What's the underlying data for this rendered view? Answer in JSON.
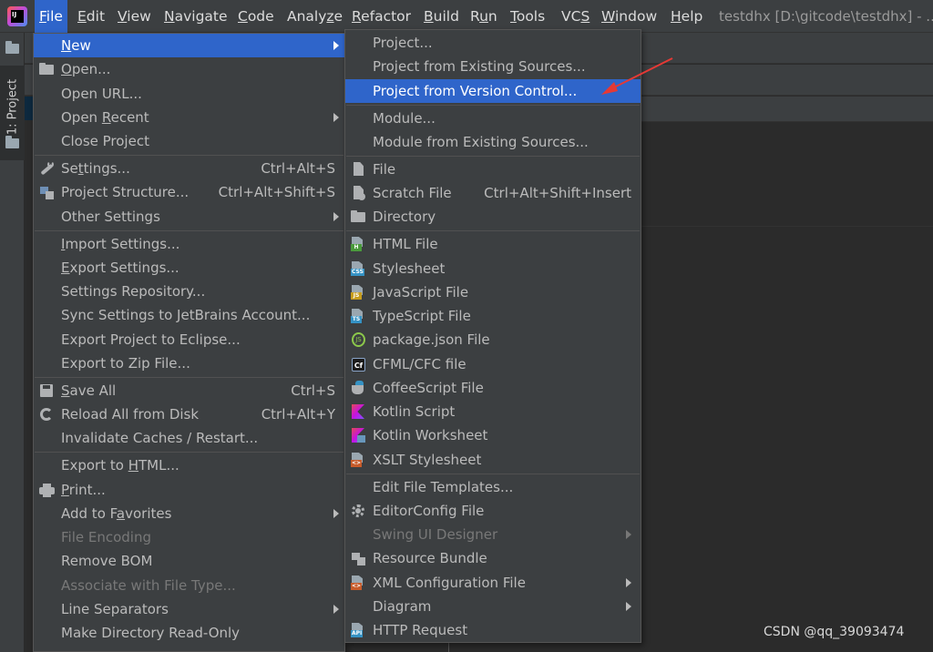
{
  "menubar": {
    "items": [
      {
        "pre": "",
        "mn": "F",
        "post": "ile",
        "active": true
      },
      {
        "pre": "",
        "mn": "E",
        "post": "dit"
      },
      {
        "pre": "",
        "mn": "V",
        "post": "iew"
      },
      {
        "pre": "",
        "mn": "N",
        "post": "avigate"
      },
      {
        "pre": "",
        "mn": "C",
        "post": "ode"
      },
      {
        "pre": "Analy",
        "mn": "z",
        "post": "e"
      },
      {
        "pre": "",
        "mn": "R",
        "post": "efactor"
      },
      {
        "pre": "",
        "mn": "B",
        "post": "uild"
      },
      {
        "pre": "R",
        "mn": "u",
        "post": "n"
      },
      {
        "pre": "",
        "mn": "T",
        "post": "ools"
      },
      {
        "pre": "VC",
        "mn": "S",
        "post": ""
      },
      {
        "pre": "",
        "mn": "W",
        "post": "indow"
      },
      {
        "pre": "",
        "mn": "H",
        "post": "elp"
      }
    ],
    "window_title": "testdhx [D:\\gitcode\\testdhx] - ..."
  },
  "tool_window": {
    "project_tab": "1: Project"
  },
  "file_menu": {
    "new": {
      "pre": "",
      "mn": "N",
      "post": "ew"
    },
    "open": {
      "pre": "",
      "mn": "O",
      "post": "pen..."
    },
    "open_url": "Open URL...",
    "open_recent": {
      "pre": "Open ",
      "mn": "R",
      "post": "ecent"
    },
    "close_project": "Close Project",
    "settings": {
      "pre": "Se",
      "mn": "t",
      "post": "tings..."
    },
    "settings_sc": "Ctrl+Alt+S",
    "project_structure": "Project Structure...",
    "project_structure_sc": "Ctrl+Alt+Shift+S",
    "other_settings": "Other Settings",
    "import_settings": {
      "pre": "",
      "mn": "I",
      "post": "mport Settings..."
    },
    "export_settings": {
      "pre": "",
      "mn": "E",
      "post": "xport Settings..."
    },
    "settings_repository": "Settings Repository...",
    "sync_settings": "Sync Settings to JetBrains Account...",
    "export_eclipse": "Export Project to Eclipse...",
    "export_zip": "Export to Zip File...",
    "save_all": {
      "pre": "",
      "mn": "S",
      "post": "ave All"
    },
    "save_all_sc": "Ctrl+S",
    "reload": "Reload All from Disk",
    "reload_sc": "Ctrl+Alt+Y",
    "invalidate": "Invalidate Caches / Restart...",
    "export_html": {
      "pre": "Export to ",
      "mn": "H",
      "post": "TML..."
    },
    "print": {
      "pre": "",
      "mn": "P",
      "post": "rint..."
    },
    "favorites": {
      "pre": "Add to F",
      "mn": "a",
      "post": "vorites"
    },
    "file_encoding": "File Encoding",
    "remove_bom": "Remove BOM",
    "associate": "Associate with File Type...",
    "line_separators": "Line Separators",
    "read_only": "Make Directory Read-Only"
  },
  "new_submenu": {
    "project": "Project...",
    "from_existing": "Project from Existing Sources...",
    "from_vcs": "Project from Version Control...",
    "module": "Module...",
    "module_existing": "Module from Existing Sources...",
    "file": "File",
    "scratch": "Scratch File",
    "scratch_sc": "Ctrl+Alt+Shift+Insert",
    "directory": "Directory",
    "html": "HTML File",
    "stylesheet": "Stylesheet",
    "javascript": "JavaScript File",
    "typescript": "TypeScript File",
    "package_json": "package.json File",
    "cfml": "CFML/CFC file",
    "coffeescript": "CoffeeScript File",
    "kotlin_script": "Kotlin Script",
    "kotlin_worksheet": "Kotlin Worksheet",
    "xslt": "XSLT Stylesheet",
    "edit_templates": "Edit File Templates...",
    "editorconfig": "EditorConfig File",
    "swing": "Swing UI Designer",
    "resource_bundle": "Resource Bundle",
    "xml_config": "XML Configuration File",
    "diagram": "Diagram",
    "http_request": "HTTP Request"
  },
  "icon_tags": {
    "html": "H",
    "css": "CSS",
    "js": "JS",
    "ts": "TS",
    "cf": "Cf",
    "xml": "<>",
    "api": "API",
    "node": "JS"
  },
  "watermark": "CSDN @qq_39093474",
  "colors": {
    "selection": "#2f65ca",
    "menu_bg": "#3c3f41",
    "annotation": "#e53935"
  }
}
